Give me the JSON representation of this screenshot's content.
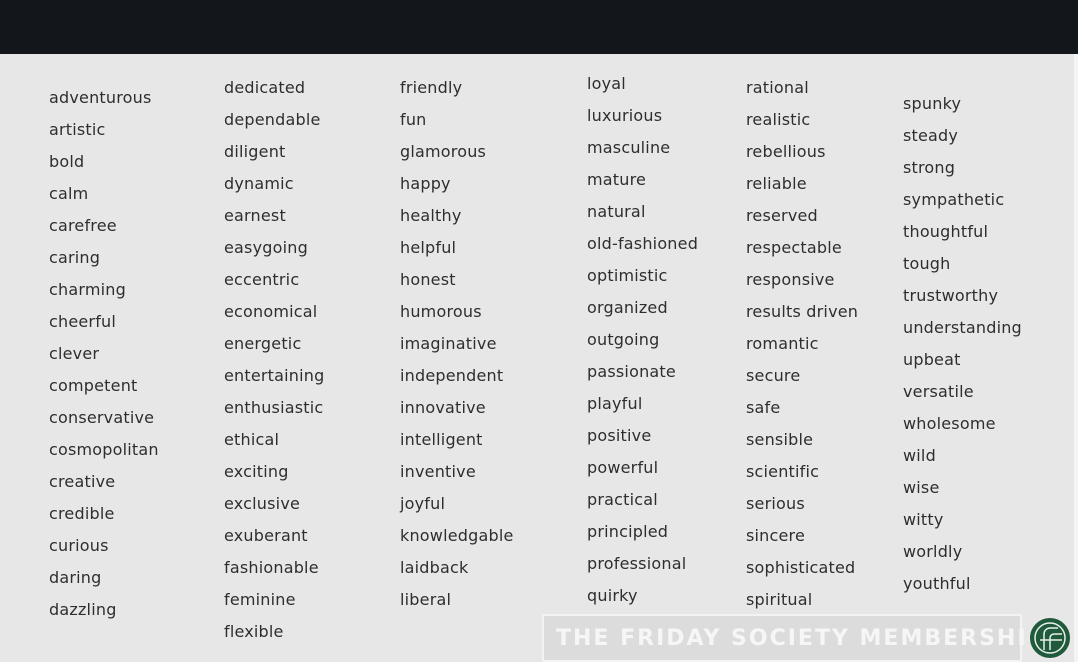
{
  "banner": {
    "text": "THE FRIDAY SOCIETY MEMBERSHIP",
    "logo_icon": "friday-society-logo",
    "logo_color": "#1f5a3a"
  },
  "columns": [
    [
      "adventurous",
      "artistic",
      "bold",
      "calm",
      "carefree",
      "caring",
      "charming",
      "cheerful",
      "clever",
      "competent",
      "conservative",
      "cosmopolitan",
      "creative",
      "credible",
      "curious",
      "daring",
      "dazzling"
    ],
    [
      "dedicated",
      "dependable",
      "diligent",
      "dynamic",
      "earnest",
      "easygoing",
      "eccentric",
      "economical",
      "energetic",
      "entertaining",
      "enthusiastic",
      "ethical",
      "exciting",
      "exclusive",
      "exuberant",
      "fashionable",
      "feminine",
      "flexible"
    ],
    [
      "friendly",
      "fun",
      "glamorous",
      "happy",
      "healthy",
      "helpful",
      "honest",
      "humorous",
      "imaginative",
      "independent",
      "innovative",
      "intelligent",
      "inventive",
      "joyful",
      "knowledgable",
      "laidback",
      "liberal"
    ],
    [
      "loyal",
      "luxurious",
      "masculine",
      "mature",
      "natural",
      "old-fashioned",
      "optimistic",
      "organized",
      "outgoing",
      "passionate",
      "playful",
      "positive",
      "powerful",
      "practical",
      "principled",
      "professional",
      "quirky"
    ],
    [
      "rational",
      "realistic",
      "rebellious",
      "reliable",
      "reserved",
      "respectable",
      "responsive",
      "results driven",
      "romantic",
      "secure",
      "safe",
      "sensible",
      "scientific",
      "serious",
      "sincere",
      "sophisticated",
      "spiritual"
    ],
    [
      "spunky",
      "steady",
      "strong",
      "sympathetic",
      "thoughtful",
      "tough",
      "trustworthy",
      "understanding",
      "upbeat",
      "versatile",
      "wholesome",
      "wild",
      "wise",
      "witty",
      "worldly",
      "youthful"
    ]
  ]
}
